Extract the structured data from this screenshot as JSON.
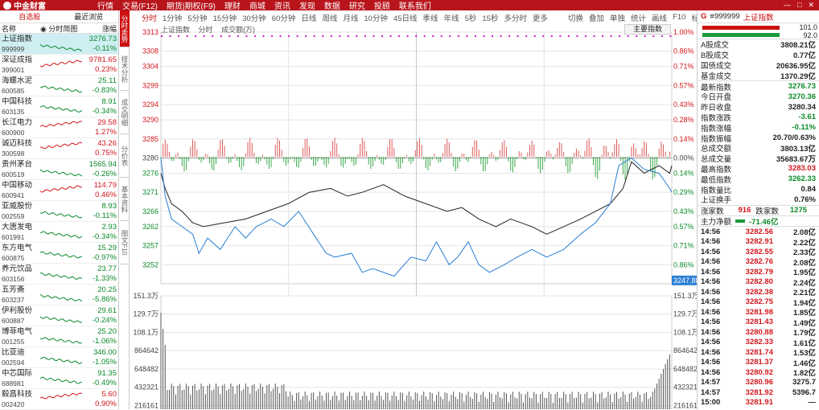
{
  "app": {
    "menu": [
      "行情",
      "交易(F12)",
      "期货|期权(F9)",
      "理财",
      "商城",
      "资讯",
      "发现",
      "数据",
      "研究",
      "投顾",
      "联系我们"
    ],
    "logo_text": "中金财富"
  },
  "left": {
    "tabs": [
      "自选股",
      "最近浏览"
    ],
    "headers": {
      "name": "名称",
      "chart": "分时简图",
      "change": "涨幅"
    },
    "stocks": [
      {
        "name": "上证指数",
        "code": "999999",
        "price": "3276.73",
        "change": "-0.11%",
        "dir": "dn",
        "sel": true
      },
      {
        "name": "深证成指",
        "code": "399001",
        "price": "9781.65",
        "change": "0.23%",
        "dir": "up"
      },
      {
        "name": "海螺水泥",
        "code": "600585",
        "price": "25.11",
        "change": "-0.83%",
        "dir": "dn"
      },
      {
        "name": "中国科技",
        "code": "603135",
        "price": "8.91",
        "change": "-0.34%",
        "dir": "dn"
      },
      {
        "name": "长江电力",
        "code": "600900",
        "price": "29.58",
        "change": "1.27%",
        "dir": "up"
      },
      {
        "name": "诚迈科技",
        "code": "300598",
        "price": "43.26",
        "change": "0.75%",
        "dir": "up"
      },
      {
        "name": "贵州茅台",
        "code": "600519",
        "price": "1565.94",
        "change": "-0.26%",
        "dir": "dn"
      },
      {
        "name": "中国移动",
        "code": "600941",
        "price": "114.79",
        "change": "0.46%",
        "dir": "up"
      },
      {
        "name": "亚威股份",
        "code": "002559",
        "price": "8.93",
        "change": "-0.11%",
        "dir": "dn"
      },
      {
        "name": "大唐发电",
        "code": "601991",
        "price": "2.93",
        "change": "-0.34%",
        "dir": "dn"
      },
      {
        "name": "东方电气",
        "code": "600875",
        "price": "15.29",
        "change": "-0.97%",
        "dir": "dn"
      },
      {
        "name": "养元饮品",
        "code": "603156",
        "price": "23.77",
        "change": "-1.33%",
        "dir": "dn"
      },
      {
        "name": "五芳斋",
        "code": "603237",
        "price": "20.25",
        "change": "-5.86%",
        "dir": "dn"
      },
      {
        "name": "伊利股份",
        "code": "600887",
        "price": "29.61",
        "change": "-0.24%",
        "dir": "dn"
      },
      {
        "name": "博菲电气",
        "code": "001255",
        "price": "25.20",
        "change": "-1.06%",
        "dir": "dn"
      },
      {
        "name": "比亚迪",
        "code": "002594",
        "price": "346.00",
        "change": "-1.05%",
        "dir": "dn"
      },
      {
        "name": "中芯国际",
        "code": "688981",
        "price": "91.35",
        "change": "-0.49%",
        "dir": "dn"
      },
      {
        "name": "毅昌科技",
        "code": "002420",
        "price": "5.60",
        "change": "0.90%",
        "dir": "up"
      }
    ]
  },
  "vtabs": [
    "分时走势",
    "技术分析",
    "成交明细",
    "分价表",
    "基本资料",
    "图文F10"
  ],
  "period_tabs": [
    "分时",
    "1分钟",
    "5分钟",
    "15分钟",
    "30分钟",
    "60分钟",
    "日线",
    "周线",
    "月线",
    "10分钟",
    "45日线",
    "季线",
    "年线",
    "5秒",
    "15秒",
    "多分时",
    "更多"
  ],
  "tool_tabs": [
    "切换",
    "叠加",
    "单独",
    "统计",
    "画线",
    "F10",
    "标记",
    "-自选",
    "返回"
  ],
  "chart_header": {
    "labels": [
      "上证指数",
      "分时",
      "成交额(万)"
    ],
    "main_index": "主要指数"
  },
  "chart_data": {
    "type": "line",
    "price_axis": {
      "min": 3247,
      "max": 3313,
      "ticks": [
        3313,
        3308,
        3304,
        3299,
        3294,
        3290,
        3285,
        3280,
        3276,
        3271,
        3266,
        3262,
        3257,
        3252
      ],
      "base": 3280.34
    },
    "pct_axis": {
      "ticks": [
        "1.00%",
        "0.86%",
        "0.71%",
        "0.57%",
        "0.43%",
        "0.28%",
        "0.14%",
        "0.00%",
        "0.14%",
        "0.29%",
        "0.43%",
        "0.57%",
        "0.71%",
        "0.86%"
      ]
    },
    "volume_axis": {
      "ticks": [
        "151.3万",
        "129.7万",
        "108.1万",
        "864642",
        "648482",
        "432321",
        "216161"
      ]
    },
    "cursor_price": "3247.88",
    "series": [
      {
        "color": "#222222",
        "points": [
          [
            0,
            3276
          ],
          [
            2,
            3272
          ],
          [
            5,
            3268
          ],
          [
            10,
            3266
          ],
          [
            15,
            3263
          ],
          [
            20,
            3262
          ],
          [
            30,
            3263
          ],
          [
            40,
            3264
          ],
          [
            50,
            3266
          ],
          [
            60,
            3268
          ],
          [
            70,
            3271
          ],
          [
            80,
            3272
          ],
          [
            88,
            3270
          ],
          [
            95,
            3271
          ],
          [
            105,
            3273
          ],
          [
            115,
            3270
          ],
          [
            125,
            3268
          ],
          [
            135,
            3266
          ],
          [
            142,
            3267
          ],
          [
            150,
            3264
          ],
          [
            158,
            3262
          ],
          [
            165,
            3264
          ],
          [
            175,
            3262
          ],
          [
            182,
            3260
          ],
          [
            190,
            3262
          ],
          [
            198,
            3264
          ],
          [
            205,
            3266
          ],
          [
            212,
            3268
          ],
          [
            218,
            3272
          ],
          [
            222,
            3279
          ],
          [
            228,
            3276
          ],
          [
            235,
            3278
          ],
          [
            240,
            3276
          ],
          [
            241,
            3278
          ]
        ]
      },
      {
        "color": "#2a7fd4",
        "points": [
          [
            0,
            3280
          ],
          [
            2,
            3270
          ],
          [
            5,
            3264
          ],
          [
            10,
            3262
          ],
          [
            15,
            3260
          ],
          [
            18,
            3255
          ],
          [
            22,
            3259
          ],
          [
            28,
            3256
          ],
          [
            35,
            3262
          ],
          [
            40,
            3259
          ],
          [
            45,
            3262
          ],
          [
            52,
            3264
          ],
          [
            58,
            3262
          ],
          [
            65,
            3266
          ],
          [
            72,
            3260
          ],
          [
            78,
            3255
          ],
          [
            82,
            3254
          ],
          [
            90,
            3255
          ],
          [
            95,
            3250
          ],
          [
            100,
            3251
          ],
          [
            110,
            3249
          ],
          [
            118,
            3254
          ],
          [
            125,
            3253
          ],
          [
            130,
            3258
          ],
          [
            136,
            3252
          ],
          [
            140,
            3254
          ],
          [
            145,
            3258
          ],
          [
            150,
            3252
          ],
          [
            155,
            3250
          ],
          [
            162,
            3252
          ],
          [
            168,
            3254
          ],
          [
            175,
            3256
          ],
          [
            182,
            3254
          ],
          [
            190,
            3256
          ],
          [
            198,
            3260
          ],
          [
            205,
            3263
          ],
          [
            212,
            3268
          ],
          [
            216,
            3278
          ],
          [
            222,
            3280
          ],
          [
            228,
            3277
          ],
          [
            235,
            3276
          ],
          [
            240,
            3272
          ],
          [
            241,
            3271
          ]
        ]
      }
    ],
    "pm_start": 120,
    "total_minutes": 241
  },
  "right": {
    "code": "999999",
    "name": "上证指数",
    "bar_vals": [
      "101.0",
      "92.0"
    ],
    "stats": [
      {
        "k": "A股成交",
        "v": "3808.21亿",
        "c": ""
      },
      {
        "k": "B股成交",
        "v": "0.77亿",
        "c": ""
      },
      {
        "k": "国债成交",
        "v": "20636.95亿",
        "c": ""
      },
      {
        "k": "基金成交",
        "v": "1370.29亿",
        "c": ""
      }
    ],
    "stats2": [
      {
        "k": "最新指数",
        "v": "3276.73",
        "c": "dn"
      },
      {
        "k": "今日开盘",
        "v": "3270.36",
        "c": "dn"
      },
      {
        "k": "昨日收盘",
        "v": "3280.34",
        "c": ""
      },
      {
        "k": "指数涨跌",
        "v": "-3.61",
        "c": "dn"
      },
      {
        "k": "指数涨幅",
        "v": "-0.11%",
        "c": "dn"
      },
      {
        "k": "指数振幅",
        "v": "20.70/0.63%",
        "c": ""
      },
      {
        "k": "总成交额",
        "v": "3803.13亿",
        "c": ""
      },
      {
        "k": "总成交量",
        "v": "35683.67万",
        "c": ""
      },
      {
        "k": "最高指数",
        "v": "3283.03",
        "c": "up"
      },
      {
        "k": "最低指数",
        "v": "3262.33",
        "c": "dn"
      },
      {
        "k": "指数量比",
        "v": "0.84",
        "c": ""
      },
      {
        "k": "上证换手",
        "v": "0.76%",
        "c": ""
      }
    ],
    "updown": {
      "up_label": "涨家数",
      "up": "916",
      "down_label": "跌家数",
      "down": "1275"
    },
    "netflow": {
      "label": "主力净额",
      "value": "-71.46亿"
    },
    "ticks": [
      [
        "14:56",
        "3282.56",
        "2.08亿"
      ],
      [
        "14:56",
        "3282.91",
        "2.22亿"
      ],
      [
        "14:56",
        "3282.55",
        "2.33亿"
      ],
      [
        "14:56",
        "3282.76",
        "2.08亿"
      ],
      [
        "14:56",
        "3282.79",
        "1.95亿"
      ],
      [
        "14:56",
        "3282.80",
        "2.24亿"
      ],
      [
        "14:56",
        "3282.38",
        "2.21亿"
      ],
      [
        "14:56",
        "3282.75",
        "1.94亿"
      ],
      [
        "14:56",
        "3281.98",
        "1.85亿"
      ],
      [
        "14:56",
        "3281.43",
        "1.49亿"
      ],
      [
        "14:56",
        "3280.88",
        "1.79亿"
      ],
      [
        "14:56",
        "3282.33",
        "1.61亿"
      ],
      [
        "14:56",
        "3281.74",
        "1.53亿"
      ],
      [
        "14:56",
        "3281.37",
        "1.46亿"
      ],
      [
        "14:56",
        "3280.92",
        "1.82亿"
      ],
      [
        "14:57",
        "3280.96",
        "3275.7"
      ],
      [
        "14:57",
        "3281.92",
        "5396.7"
      ],
      [
        "15:00",
        "3281.91",
        "—"
      ]
    ]
  }
}
